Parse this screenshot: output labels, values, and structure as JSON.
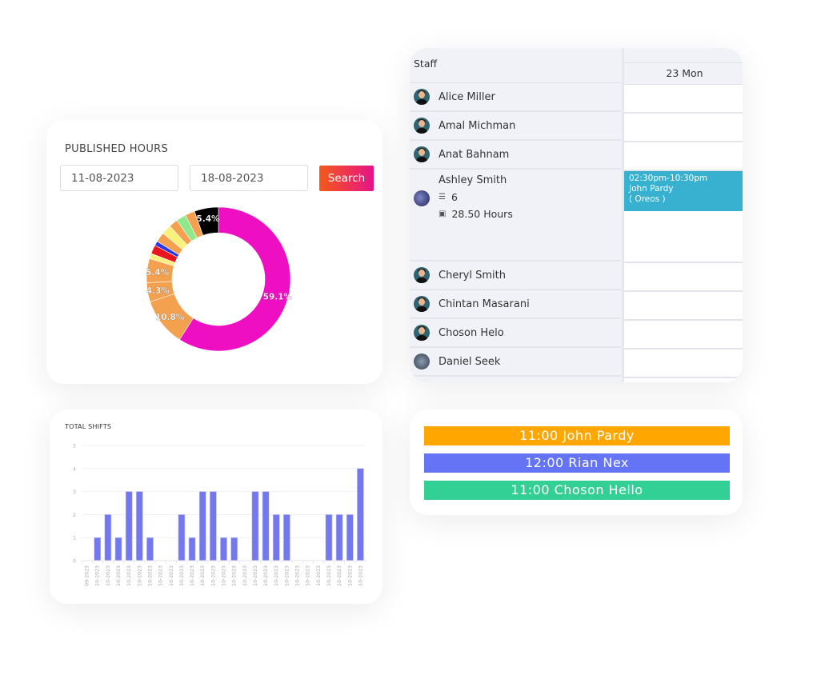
{
  "published_hours": {
    "title": "PUBLISHED HOURS",
    "date_from": "11-08-2023",
    "date_to": "18-08-2023",
    "search_label": "Search",
    "search_colors": [
      "#f25a1a",
      "#e3148a"
    ]
  },
  "chart_data": [
    {
      "type": "pie",
      "title": "Published Hours",
      "donut": true,
      "slices": [
        {
          "label": "59.1%",
          "value": 59.1,
          "color": "#ef0fc2",
          "show_label": true
        },
        {
          "label": "10.8%",
          "value": 10.8,
          "color": "#f3a04f",
          "show_label": true
        },
        {
          "label": "4.3%",
          "value": 4.3,
          "color": "#f3a04f",
          "show_label": true
        },
        {
          "label": "5.4%",
          "value": 5.4,
          "color": "#f3a04f",
          "show_label": true
        },
        {
          "label": "",
          "value": 1.2,
          "color": "#f6f07a",
          "show_label": false
        },
        {
          "label": "",
          "value": 2.0,
          "color": "#e8141e",
          "show_label": false
        },
        {
          "label": "",
          "value": 1.0,
          "color": "#2b36e8",
          "show_label": false
        },
        {
          "label": "",
          "value": 2.2,
          "color": "#f3a04f",
          "show_label": false
        },
        {
          "label": "",
          "value": 2.2,
          "color": "#f8f17a",
          "show_label": false
        },
        {
          "label": "",
          "value": 2.0,
          "color": "#f3a04f",
          "show_label": false
        },
        {
          "label": "",
          "value": 2.2,
          "color": "#8fe88a",
          "show_label": false
        },
        {
          "label": "",
          "value": 2.2,
          "color": "#f3a04f",
          "show_label": false
        },
        {
          "label": "5.4%",
          "value": 5.4,
          "color": "#000000",
          "show_label": true
        }
      ]
    },
    {
      "type": "bar",
      "title": "TOTAL SHIFTS",
      "categories": [
        "09-2023",
        "10-2023",
        "10-2023",
        "10-2023",
        "10-2023",
        "10-2023",
        "10-2023",
        "10-2023",
        "10-2023",
        "10-2023",
        "10-2023",
        "10-2023",
        "10-2023",
        "10-2023",
        "10-2023",
        "10-2023",
        "10-2023",
        "10-2023",
        "10-2023",
        "10-2023",
        "10-2023",
        "10-2023",
        "10-2023",
        "10-2023",
        "10-2023",
        "10-2023",
        "10-2023"
      ],
      "values": [
        0,
        1,
        2,
        1,
        3,
        3,
        1,
        0,
        0,
        2,
        1,
        3,
        3,
        1,
        1,
        0,
        3,
        3,
        2,
        2,
        0,
        0,
        0,
        2,
        2,
        2,
        4
      ],
      "yticks": [
        0,
        1,
        2,
        3,
        4,
        5
      ],
      "ylim": [
        0,
        5
      ],
      "xlabel": "",
      "ylabel": "",
      "bar_color": "#7378ee",
      "grid": true
    }
  ],
  "staff_schedule": {
    "header_label": "Staff",
    "day_label": "23 Mon",
    "staff": [
      {
        "name": "Alice Miller",
        "avatar": "cartoon"
      },
      {
        "name": "Amal Michman",
        "avatar": "cartoon"
      },
      {
        "name": "Anat Bahnam",
        "avatar": "cartoon"
      },
      {
        "name": "Ashley Smith",
        "avatar": "photo",
        "shift_count": "6",
        "hours": "28.50 Hours",
        "shift": {
          "time": "02:30pm-10:30pm",
          "person": "John Pardy",
          "location": "( Oreos )",
          "color": "#38b0d0"
        }
      },
      {
        "name": "Cheryl Smith",
        "avatar": "cartoon"
      },
      {
        "name": "Chintan Masarani",
        "avatar": "cartoon"
      },
      {
        "name": "Choson Helo",
        "avatar": "cartoon"
      },
      {
        "name": "Daniel Seek",
        "avatar": "photo"
      }
    ]
  },
  "shift_pills": [
    {
      "label": "11:00 John Pardy",
      "color": "#ffa600"
    },
    {
      "label": "12:00 Rian Nex",
      "color": "#6474f4"
    },
    {
      "label": "11:00 Choson Hello",
      "color": "#33d095"
    }
  ]
}
